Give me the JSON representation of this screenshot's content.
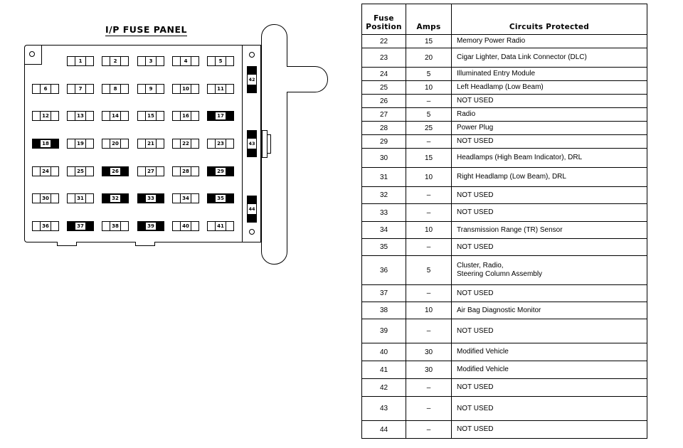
{
  "diagram": {
    "title": "I/P FUSE PANEL",
    "fuse_rows": [
      [
        null,
        "1",
        "2",
        "3",
        "4",
        "5"
      ],
      [
        "6",
        "7",
        "8",
        "9",
        "10",
        "11"
      ],
      [
        "12",
        "13",
        "14",
        "15",
        "16",
        "17"
      ],
      [
        "18",
        "19",
        "20",
        "21",
        "22",
        "23"
      ],
      [
        "24",
        "25",
        "26",
        "27",
        "28",
        "29"
      ],
      [
        "30",
        "31",
        "32",
        "33",
        "34",
        "35"
      ],
      [
        "36",
        "37",
        "38",
        "39",
        "40",
        "41"
      ]
    ],
    "filled_fuses": [
      "17",
      "18",
      "26",
      "29",
      "32",
      "33",
      "35",
      "37",
      "39",
      "42",
      "43",
      "44"
    ],
    "vertical_fuses": [
      "42",
      "43",
      "44"
    ]
  },
  "table": {
    "headers": {
      "position_line1": "Fuse",
      "position_line2": "Position",
      "amps": "Amps",
      "circuits": "Circuits Protected"
    },
    "rows": [
      {
        "position": "22",
        "amps": "15",
        "circuits": [
          "Memory Power Radio"
        ]
      },
      {
        "position": "23",
        "amps": "20",
        "circuits": [
          "Cigar Lighter, Data Link Connector (DLC)"
        ]
      },
      {
        "position": "24",
        "amps": "5",
        "circuits": [
          "Illuminated Entry Module"
        ]
      },
      {
        "position": "25",
        "amps": "10",
        "circuits": [
          "Left  Headlamp (Low Beam)"
        ]
      },
      {
        "position": "26",
        "amps": "–",
        "circuits": [
          "NOT USED"
        ]
      },
      {
        "position": "27",
        "amps": "5",
        "circuits": [
          "Radio"
        ]
      },
      {
        "position": "28",
        "amps": "25",
        "circuits": [
          "Power Plug"
        ]
      },
      {
        "position": "29",
        "amps": "–",
        "circuits": [
          "NOT USED"
        ]
      },
      {
        "position": "30",
        "amps": "15",
        "circuits": [
          "Headlamps  (High Beam Indicator), DRL"
        ]
      },
      {
        "position": "31",
        "amps": "10",
        "circuits": [
          "Right Headlamp (Low Beam), DRL"
        ]
      },
      {
        "position": "32",
        "amps": "–",
        "circuits": [
          "NOT USED"
        ]
      },
      {
        "position": "33",
        "amps": "–",
        "circuits": [
          "NOT USED"
        ]
      },
      {
        "position": "34",
        "amps": "10",
        "circuits": [
          "Transmission Range (TR) Sensor"
        ]
      },
      {
        "position": "35",
        "amps": "–",
        "circuits": [
          "NOT USED"
        ]
      },
      {
        "position": "36",
        "amps": "5",
        "circuits": [
          "Cluster, Radio,",
          "Steering Column Assembly"
        ]
      },
      {
        "position": "37",
        "amps": "–",
        "circuits": [
          "NOT USED"
        ]
      },
      {
        "position": "38",
        "amps": "10",
        "circuits": [
          "Air Bag Diagnostic Monitor"
        ]
      },
      {
        "position": "39",
        "amps": "–",
        "circuits": [
          "NOT USED"
        ]
      },
      {
        "position": "40",
        "amps": "30",
        "circuits": [
          "Modified  Vehicle"
        ]
      },
      {
        "position": "41",
        "amps": "30",
        "circuits": [
          "Modified Vehicle"
        ]
      },
      {
        "position": "42",
        "amps": "–",
        "circuits": [
          "NOT USED"
        ]
      },
      {
        "position": "43",
        "amps": "–",
        "circuits": [
          "NOT USED"
        ]
      },
      {
        "position": "44",
        "amps": "–",
        "circuits": [
          "NOT USED"
        ]
      }
    ]
  }
}
